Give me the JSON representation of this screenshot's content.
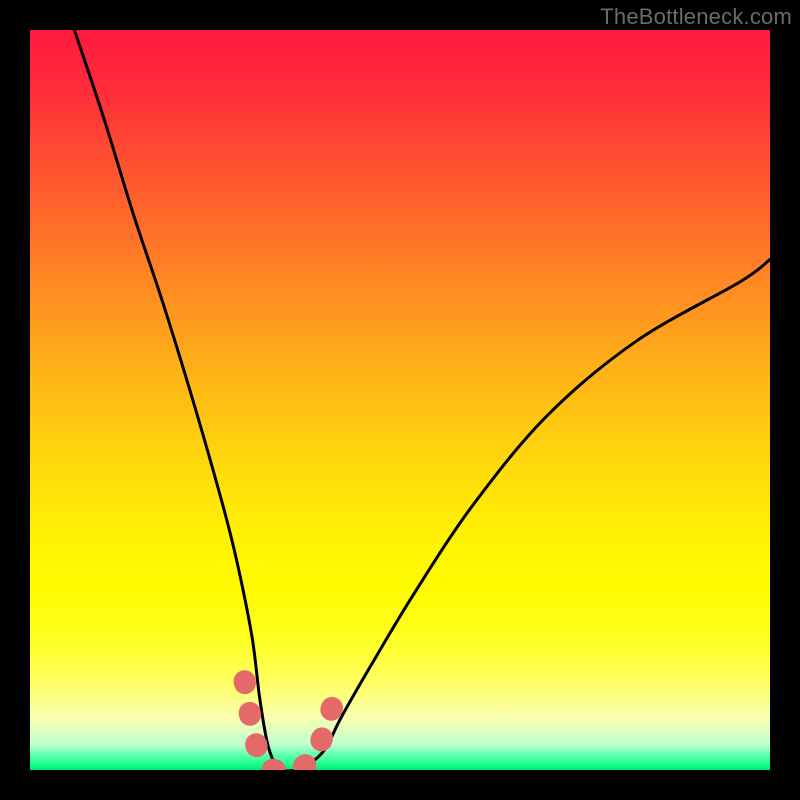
{
  "watermark": "TheBottleneck.com",
  "chart_data": {
    "type": "line",
    "title": "",
    "xlabel": "",
    "ylabel": "",
    "xlim": [
      0,
      100
    ],
    "ylim": [
      0,
      100
    ],
    "grid": false,
    "series": [
      {
        "name": "bottleneck-curve",
        "color": "#000000",
        "x": [
          6,
          10,
          14,
          18,
          22,
          26,
          28,
          30,
          31,
          32,
          33,
          34,
          36,
          38,
          40,
          42,
          46,
          52,
          60,
          70,
          82,
          96,
          100
        ],
        "y": [
          100,
          88,
          75,
          63,
          50,
          36,
          28,
          18,
          10,
          4,
          1,
          0,
          0,
          1,
          3,
          7,
          14,
          24,
          36,
          48,
          58,
          66,
          69
        ]
      },
      {
        "name": "highlight-floor",
        "color": "#e46a6a",
        "x": [
          29,
          30,
          31,
          32,
          33,
          34,
          35,
          36,
          37,
          38,
          39,
          41,
          42
        ],
        "y": [
          12,
          6,
          2,
          0.5,
          0,
          0,
          0,
          0,
          0.5,
          1.5,
          3,
          9,
          12
        ]
      }
    ],
    "annotations": []
  },
  "colors": {
    "frame": "#000000",
    "curve": "#000000",
    "highlight": "#e46a6a",
    "watermark": "#6b6b6b"
  }
}
